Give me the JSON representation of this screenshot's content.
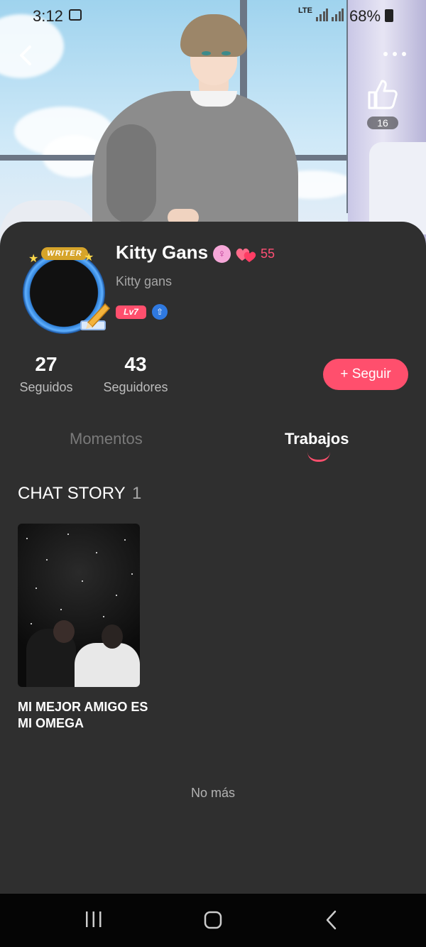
{
  "status_bar": {
    "time": "3:12",
    "network": "LTE",
    "battery": "68%"
  },
  "header": {
    "like_count": "16",
    "back_icon": "back-arrow-icon",
    "more_icon": "more-dots-icon",
    "like_icon": "thumbs-up-icon"
  },
  "profile": {
    "avatar_badge": "WRITER",
    "name": "Kitty Gans",
    "hearts_count": "55",
    "handle": "Kitty gans",
    "level": "Lv7"
  },
  "stats": {
    "following_count": "27",
    "following_label": "Seguidos",
    "followers_count": "43",
    "followers_label": "Seguidores"
  },
  "follow_button": {
    "icon": "+",
    "label": "Seguir"
  },
  "tabs": [
    {
      "label": "Momentos",
      "active": false
    },
    {
      "label": "Trabajos",
      "active": true
    }
  ],
  "section": {
    "title": "CHAT STORY",
    "count": "1"
  },
  "stories": [
    {
      "title": "MI MEJOR AMIGO ES MI OMEGA"
    }
  ],
  "no_more_text": "No más",
  "colors": {
    "accent": "#ff4f6d",
    "panel_bg": "#2f2f2f",
    "nav_bg": "#050505"
  }
}
